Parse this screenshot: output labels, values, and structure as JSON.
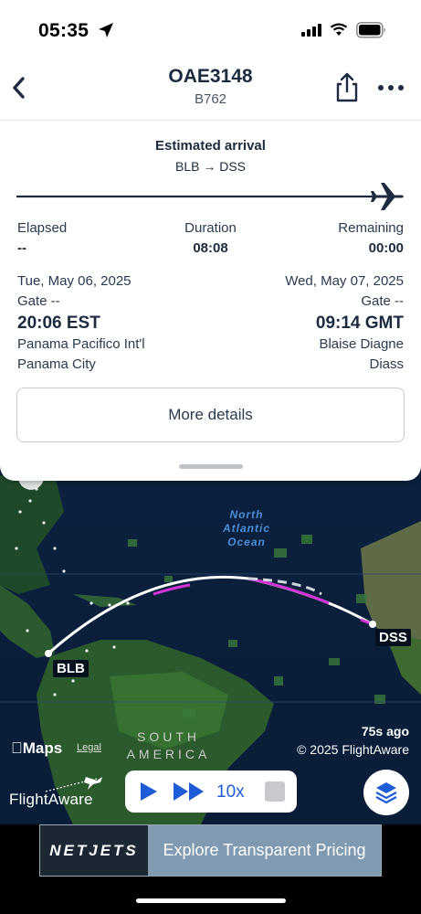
{
  "status_bar": {
    "time": "05:35"
  },
  "header": {
    "flight_number": "OAE3148",
    "aircraft": "B762"
  },
  "summary": {
    "title": "Estimated arrival",
    "route": "BLB → DSS",
    "progress_fraction": 1.0
  },
  "times": {
    "elapsed_label": "Elapsed",
    "elapsed_value": "--",
    "duration_label": "Duration",
    "duration_value": "08:08",
    "remaining_label": "Remaining",
    "remaining_value": "00:00"
  },
  "departure": {
    "date": "Tue, May 06, 2025",
    "gate": "Gate --",
    "time": "20:06 EST",
    "airport": "Panama Pacifico Int'l",
    "city": "Panama City"
  },
  "arrival": {
    "date": "Wed, May 07, 2025",
    "gate": "Gate --",
    "time": "09:14 GMT",
    "airport": "Blaise Diagne",
    "city": "Diass"
  },
  "details_button": "More details",
  "map": {
    "ocean_label": "North Atlantic Ocean",
    "continent_label": "SOUTH AMERICA",
    "origin_code": "BLB",
    "destination_code": "DSS",
    "maps_brand": "Maps",
    "legal": "Legal",
    "updated": "75s ago",
    "copyright": "© 2025 FlightAware",
    "provider": "FlightAware",
    "playback_speed": "10x"
  },
  "ad": {
    "brand": "NETJETS",
    "cta": "Explore Transparent Pricing"
  },
  "colors": {
    "accent": "#1e5bd6",
    "track_line": "#ffffff",
    "track_highlight": "#d633d6",
    "text_dark": "#1c2b3f"
  }
}
